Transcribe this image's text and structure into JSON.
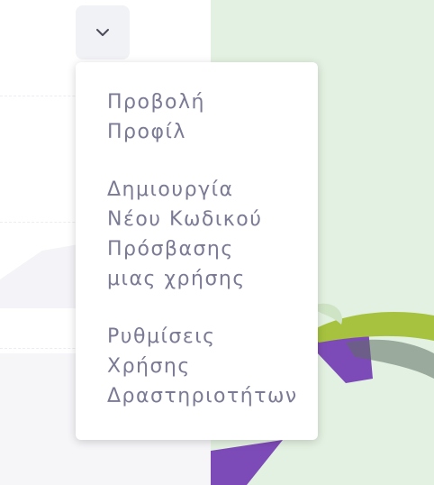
{
  "dropdown": {
    "items": [
      {
        "label_lines": [
          "Προβολή",
          "Προφίλ"
        ]
      },
      {
        "label_lines": [
          "Δημιουργία",
          "Νέου Κωδικού",
          "Πρόσβασης",
          "μιας χρήσης"
        ]
      },
      {
        "label_lines": [
          "Ρυθμίσεις",
          "Χρήσης",
          "Δραστηριοτήτων"
        ]
      }
    ]
  },
  "icons": {
    "toggle": "chevron-down-icon"
  },
  "colors": {
    "menu_text": "#7a7a95",
    "toggle_bg": "#f1f2f6",
    "backdrop_green": "#e3f1e2",
    "leaf_green": "#a6c23e",
    "shape_purple": "#7d4bb7"
  }
}
